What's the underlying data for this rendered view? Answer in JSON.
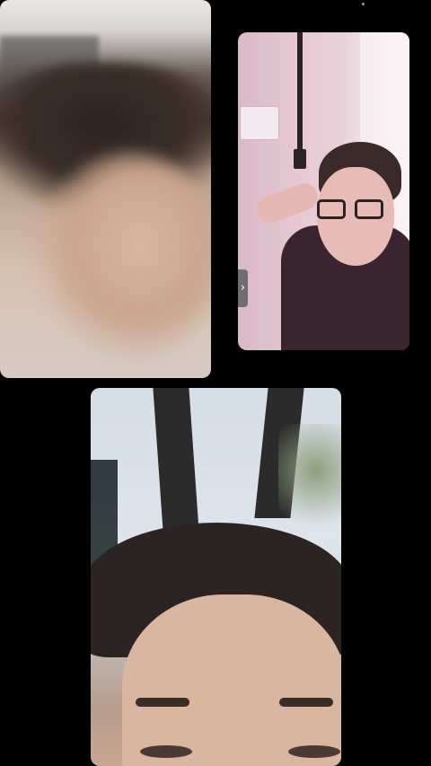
{
  "app": {
    "screen": "video-call-grid"
  },
  "participants": [
    {
      "icon": "video-feed-blurred-selfie"
    },
    {
      "icon": "video-feed-girl-with-glasses"
    },
    {
      "icon": "video-feed-forehead-closeup"
    }
  ],
  "controls": {
    "expand_icon": "chevron-right-icon",
    "expand_glyph": "›"
  },
  "colors": {
    "background": "#000000",
    "control_gray": "#6e6e6e"
  }
}
